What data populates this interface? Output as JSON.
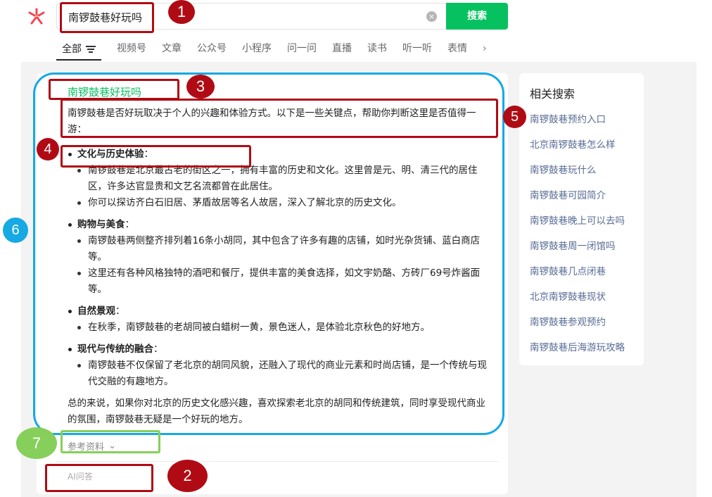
{
  "search": {
    "query": "南锣鼓巷好玩吗",
    "clear_glyph": "×",
    "button_label": "搜索"
  },
  "tabs": [
    {
      "label": "全部"
    },
    {
      "label": "视频号"
    },
    {
      "label": "文章"
    },
    {
      "label": "公众号"
    },
    {
      "label": "小程序"
    },
    {
      "label": "问一问"
    },
    {
      "label": "直播"
    },
    {
      "label": "读书"
    },
    {
      "label": "听一听"
    },
    {
      "label": "表情"
    }
  ],
  "tab_more_glyph": "›",
  "answer": {
    "title": "南锣鼓巷好玩吗",
    "intro": "南锣鼓巷是否好玩取决于个人的兴趣和体验方式。以下是一些关键点，帮助你判断这里是否值得一游：",
    "sections": [
      {
        "heading": "文化与历史体验",
        "items": [
          "南锣鼓巷是北京最古老的街区之一，拥有丰富的历史和文化。这里曾是元、明、清三代的居住区，许多达官显贵和文艺名流都曾在此居住。",
          "你可以探访齐白石旧居、茅盾故居等名人故居，深入了解北京的历史文化。"
        ]
      },
      {
        "heading": "购物与美食",
        "items": [
          "南锣鼓巷两侧整齐排列着16条小胡同，其中包含了许多有趣的店铺，如时光杂货铺、蓝白商店等。",
          "这里还有各种风格独特的酒吧和餐厅，提供丰富的美食选择，如文宇奶酪、方砖厂69号炸酱面等。"
        ]
      },
      {
        "heading": "自然景观",
        "items": [
          "在秋季，南锣鼓巷的老胡同被白蜡树一黄，景色迷人，是体验北京秋色的好地方。"
        ]
      },
      {
        "heading": "现代与传统的融合",
        "items": [
          "南锣鼓巷不仅保留了老北京的胡同风貌，还融入了现代的商业元素和时尚店铺，是一个传统与现代交融的有趣地方。"
        ]
      }
    ],
    "colon": "：",
    "conclusion": "总的来说，如果你对北京的历史文化感兴趣，喜欢探索老北京的胡同和传统建筑，同时享受现代商业的氛围，南锣鼓巷无疑是一个好玩的地方。",
    "references_label": "参考资料",
    "references_glyph": "⌄",
    "ai_label": "AI问答"
  },
  "related": {
    "title": "相关搜索",
    "items": [
      "南锣鼓巷预约入口",
      "北京南锣鼓巷怎么样",
      "南锣鼓巷玩什么",
      "南锣鼓巷可园简介",
      "南锣鼓巷晚上可以去吗",
      "南锣鼓巷周一闭馆吗",
      "南锣鼓巷几点闭巷",
      "北京南锣鼓巷现状",
      "南锣鼓巷参观预约",
      "南锣鼓巷后海游玩攻略"
    ]
  },
  "annotations": {
    "b1": "1",
    "b2": "2",
    "b3": "3",
    "b4": "4",
    "b5": "5",
    "b6": "6",
    "b7": "7"
  },
  "colors": {
    "brand_green": "#07c160",
    "link_blue": "#576b95",
    "annotation_red": "#b00b14",
    "annotation_blue": "#16a9e3",
    "annotation_green": "#86cf5a"
  }
}
